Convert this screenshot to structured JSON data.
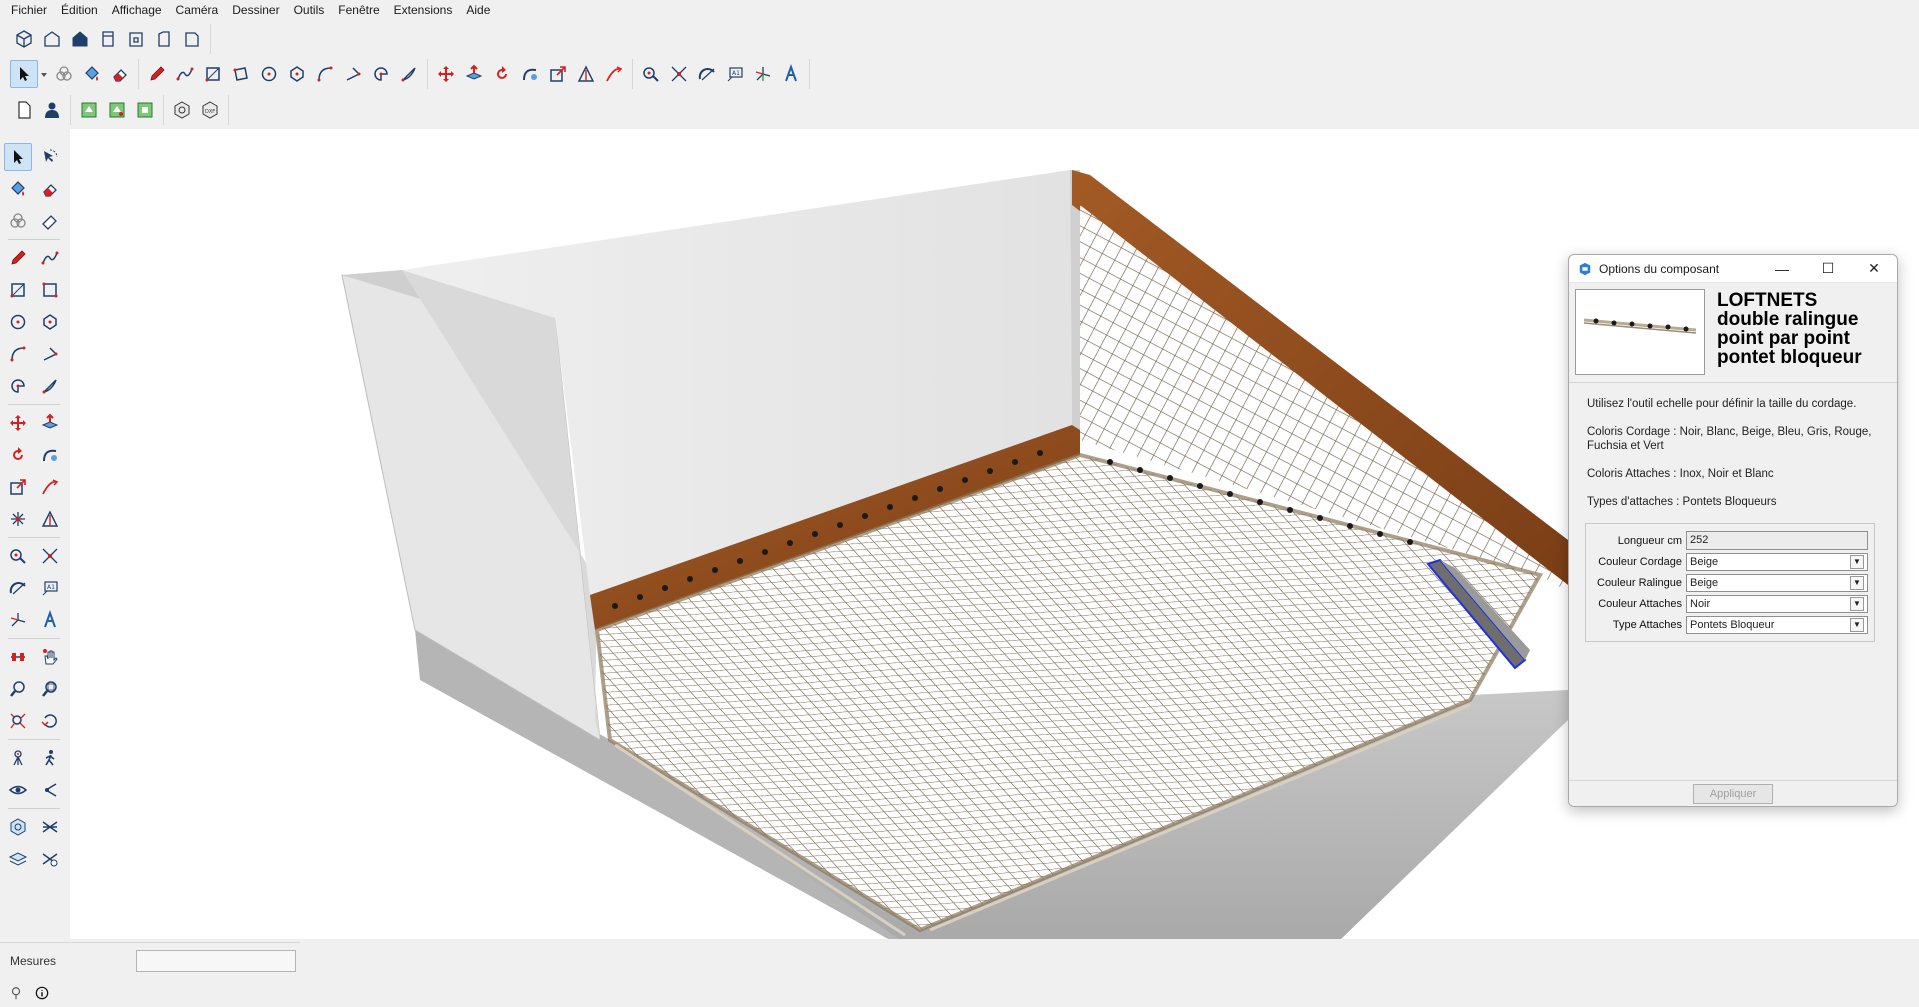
{
  "menu": {
    "items": [
      "Fichier",
      "Édition",
      "Affichage",
      "Caméra",
      "Dessiner",
      "Outils",
      "Fenêtre",
      "Extensions",
      "Aide"
    ]
  },
  "measures": {
    "label": "Mesures",
    "value": ""
  },
  "dialog": {
    "title": "Options du composant",
    "brand_lines": [
      "LOFTNETS",
      "double ralingue",
      "point par point",
      "pontet bloqueur"
    ],
    "paragraphs": [
      "Utilisez l'outil echelle pour définir la taille du cordage.",
      "Coloris Cordage : Noir, Blanc, Beige, Bleu, Gris, Rouge, Fuchsia et Vert",
      "Coloris Attaches : Inox, Noir et Blanc",
      "Types d'attaches : Pontets Bloqueurs"
    ],
    "fields": [
      {
        "label": "Longueur cm",
        "value": "252",
        "kind": "input"
      },
      {
        "label": "Couleur Cordage",
        "value": "Beige",
        "kind": "select"
      },
      {
        "label": "Couleur Ralingue",
        "value": "Beige",
        "kind": "select"
      },
      {
        "label": "Couleur Attaches",
        "value": "Noir",
        "kind": "select"
      },
      {
        "label": "Type Attaches",
        "value": "Pontets Bloqueur",
        "kind": "select"
      }
    ],
    "apply_label": "Appliquer"
  },
  "colors": {
    "accent": "#0078d4",
    "tool_red": "#d42020",
    "tool_blue": "#1f5fa8",
    "wood": "#8a4a1f",
    "net": "#7a6a52",
    "concrete": "#b8b8b8"
  },
  "icons": {
    "toolbar_row1": [
      "cube-icon",
      "house-front-icon",
      "house-side-icon",
      "house-top-icon",
      "house-back-icon",
      "house-left-icon"
    ],
    "toolbar_row2": [
      "select-icon",
      "component-icon",
      "paint-bucket-icon",
      "eraser-icon",
      "pencil-icon",
      "freehand-icon",
      "rectangle-icon",
      "rotated-rect-icon",
      "circle-icon",
      "polygon-icon",
      "arc-icon",
      "arc2-icon",
      "pie-icon",
      "arc3-icon",
      "move-icon",
      "push-pull-icon",
      "rotate-icon",
      "follow-me-icon",
      "scale-icon",
      "offset-icon",
      "path-icon",
      "tape-icon",
      "dimension-icon",
      "protractor-icon",
      "text-icon",
      "axes-icon",
      "3d-text-icon"
    ],
    "toolbar_row3": [
      "new-doc-icon",
      "user-icon",
      "layer-green-icon",
      "layer-green2-icon",
      "layer-green3-icon",
      "import-3d-icon",
      "export-dxf-icon"
    ]
  }
}
